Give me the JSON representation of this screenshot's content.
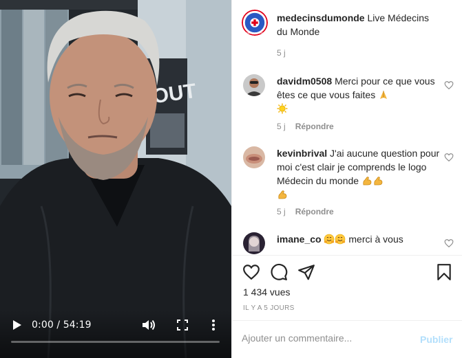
{
  "video": {
    "current_time": "0:00",
    "separator": " / ",
    "duration": "54:19",
    "progress": 0.0,
    "poster_text": "OUT"
  },
  "caption": {
    "username": "medecinsdumonde",
    "text": "Live Médecins du Monde",
    "time": "5 j",
    "avatar_text": "MÉDECINS DU MONDE"
  },
  "comments": [
    {
      "username": "davidm0508",
      "text": "Merci pour ce que vous êtes ce que vous faites",
      "emojis": [
        "folded-hands",
        "sun"
      ],
      "time": "5 j",
      "reply_label": "Répondre"
    },
    {
      "username": "kevinbrival",
      "text": "J'ai aucune question pour moi c'est clair je comprends le logo Médecin du monde",
      "emojis": [
        "flexed-biceps",
        "flexed-biceps",
        "flexed-biceps"
      ],
      "time": "5 j",
      "reply_label": "Répondre"
    },
    {
      "username": "imane_co",
      "text": "merci à vous",
      "emojis": [
        "hugging-face",
        "hugging-face"
      ]
    }
  ],
  "stats": {
    "views": "1 434 vues",
    "date": "IL Y A 5 JOURS"
  },
  "composer": {
    "placeholder": "Ajouter un commentaire...",
    "publish_label": "Publier"
  },
  "colors": {
    "accent_disabled": "#b2dffc",
    "secondary_text": "#8e8e8e",
    "brand_red": "#e1001a",
    "brand_blue": "#2b59c3"
  }
}
